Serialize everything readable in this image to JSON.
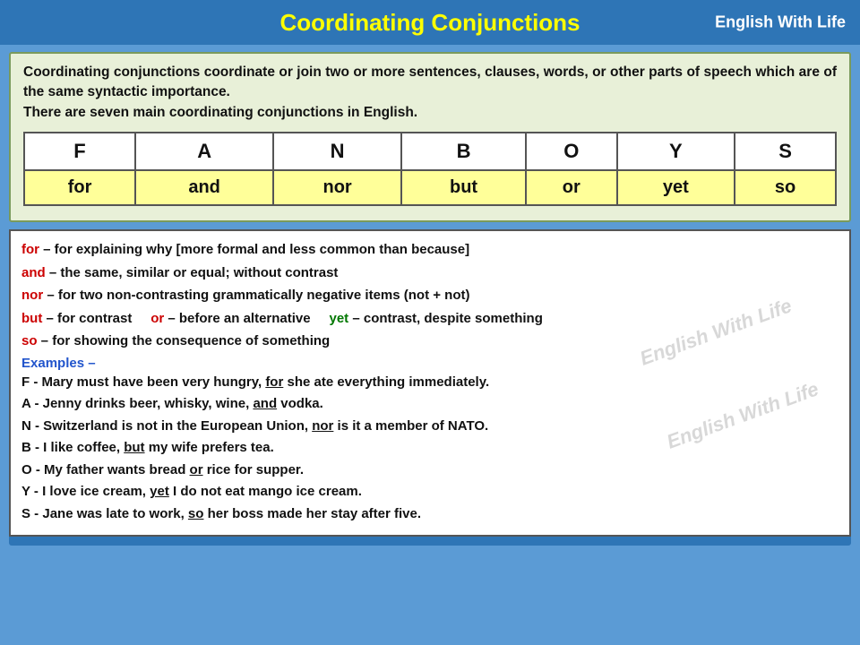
{
  "header": {
    "title": "Coordinating Conjunctions",
    "brand": "English With Life"
  },
  "intro": {
    "line1": "Coordinating conjunctions coordinate or join two or more sentences, clauses, words, or other parts of speech which are of the same syntactic importance.",
    "line2": "There are seven main coordinating conjunctions in English."
  },
  "fanboys": {
    "letters": [
      "F",
      "A",
      "N",
      "B",
      "O",
      "Y",
      "S"
    ],
    "words": [
      "for",
      "and",
      "nor",
      "but",
      "or",
      "yet",
      "so"
    ]
  },
  "definitions": {
    "for_label": "for",
    "for_def": " – for explaining why [more formal and less common than because]",
    "and_label": "and",
    "and_def": " – the same, similar or equal; without contrast",
    "nor_label": "nor",
    "nor_def": " – for two non-contrasting grammatically negative items (not + not)",
    "but_label": "but",
    "but_def": " – for contrast",
    "or_label": "or",
    "or_def": " – before an alternative",
    "yet_label": "yet",
    "yet_def": " – contrast, despite something",
    "so_label": "so",
    "so_def": "  – for showing the consequence of something"
  },
  "examples": {
    "header": "Examples –",
    "f_letter": "F",
    "f_text": " - Mary must have been very hungry, ",
    "f_conj": "for",
    "f_rest": " she ate everything immediately.",
    "a_letter": "A",
    "a_text": " - Jenny drinks beer, whisky, wine, ",
    "a_conj": "and",
    "a_rest": " vodka.",
    "n_letter": "N",
    "n_text": " - Switzerland is not in the European Union, ",
    "n_conj": "nor",
    "n_rest": " is it a member of NATO.",
    "b_letter": "B",
    "b_text": " - I like coffee, ",
    "b_conj": "but",
    "b_rest": " my wife prefers tea.",
    "o_letter": "O",
    "o_text": " - My father wants bread ",
    "o_conj": "or",
    "o_rest": " rice for supper.",
    "y_letter": "Y",
    "y_text": " - I love ice cream, ",
    "y_conj": "yet",
    "y_rest": " I do not eat mango ice cream.",
    "s_letter": "S",
    "s_text": " - Jane was late to work, ",
    "s_conj": "so",
    "s_rest": " her boss made her stay after five."
  },
  "watermarks": [
    "English With Life",
    "English With Life"
  ]
}
